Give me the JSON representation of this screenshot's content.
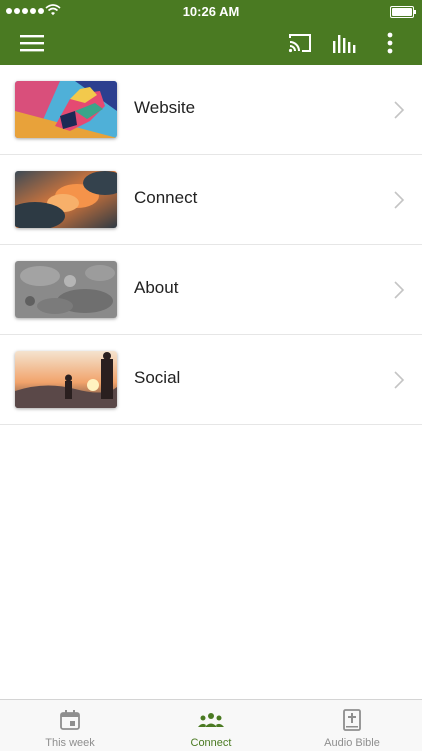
{
  "status_bar": {
    "time": "10:26 AM"
  },
  "app_bar": {
    "menu_icon": "hamburger-menu-icon",
    "cast_icon": "cast-icon",
    "audio_bars_icon": "audio-bars-icon",
    "more_icon": "more-vertical-icon"
  },
  "colors": {
    "brand_green": "#4a7a22",
    "active_tab": "#4a7a22",
    "inactive_tab": "#8e8e8e"
  },
  "menu_items": [
    {
      "label": "Website",
      "thumbnail": "colorful-painted-hand"
    },
    {
      "label": "Connect",
      "thumbnail": "orange-cloudy-sky"
    },
    {
      "label": "About",
      "thumbnail": "gray-rock-texture"
    },
    {
      "label": "Social",
      "thumbnail": "people-at-sunset"
    }
  ],
  "tabs": [
    {
      "label": "This week",
      "icon": "calendar-icon",
      "active": false
    },
    {
      "label": "Connect",
      "icon": "people-group-icon",
      "active": true
    },
    {
      "label": "Audio Bible",
      "icon": "bible-icon",
      "active": false
    }
  ]
}
